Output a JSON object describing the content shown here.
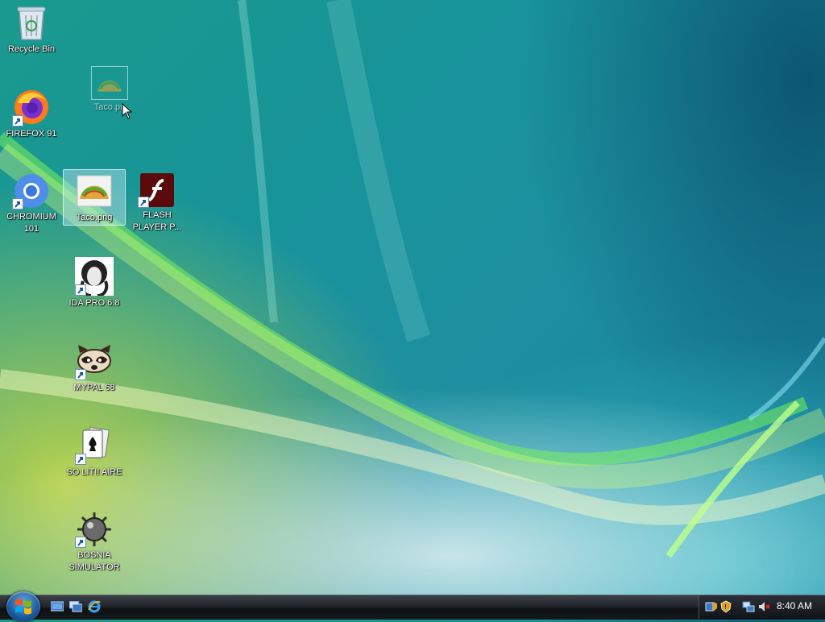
{
  "desktop": {
    "icons": [
      {
        "label": "Recycle Bin"
      },
      {
        "label": "FIREFOX 91"
      },
      {
        "label": "CHROMIUM\n101"
      },
      {
        "label": "Taco.png"
      },
      {
        "label": "FLASH\nPLAYER P..."
      },
      {
        "label": "IDA PRO 6.8"
      },
      {
        "label": "MYPAL 68"
      },
      {
        "label": "SO LIT!! AIRE"
      },
      {
        "label": "BOSNIA\nSIMULATOR"
      }
    ],
    "drag_ghost_label": "Taco.pn"
  },
  "taskbar": {
    "clock": "8:40 AM"
  },
  "colors": {
    "taskbar": "#1b1e22",
    "selection": "#bfe6f0"
  }
}
